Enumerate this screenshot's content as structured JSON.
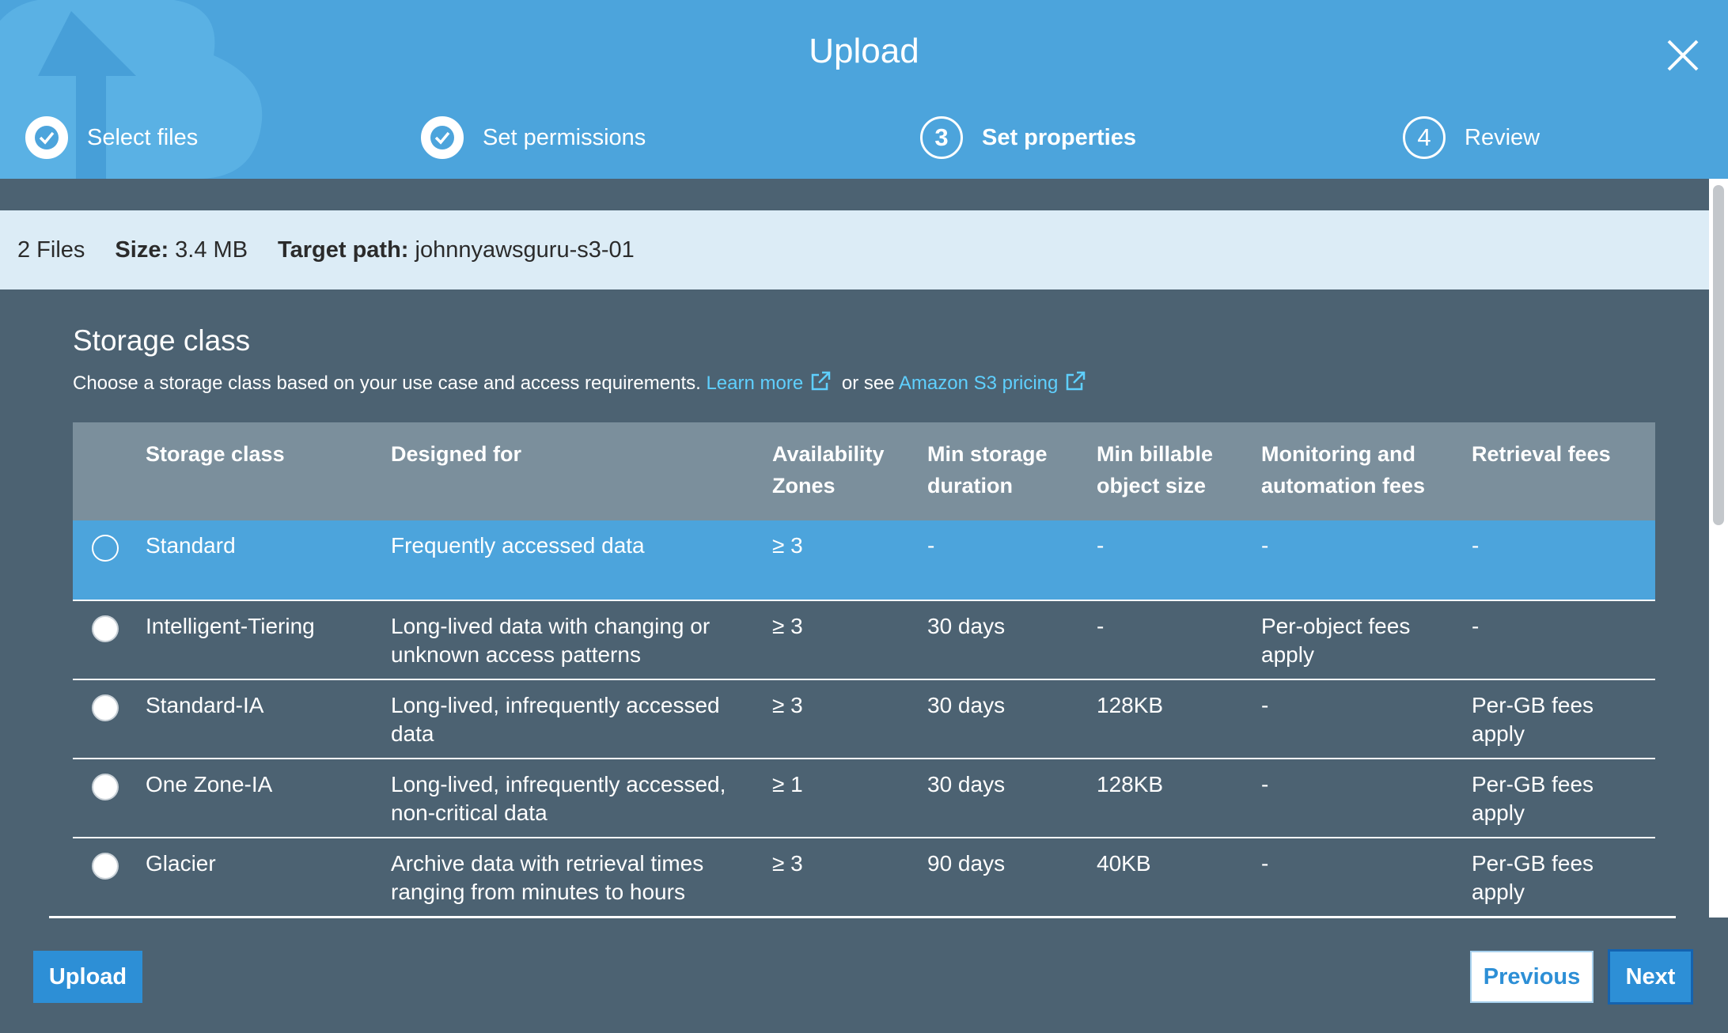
{
  "dialog": {
    "title": "Upload"
  },
  "steps": [
    {
      "label": "Select files",
      "number": "",
      "status": "done"
    },
    {
      "label": "Set permissions",
      "number": "",
      "status": "done"
    },
    {
      "label": "Set properties",
      "number": "3",
      "status": "current"
    },
    {
      "label": "Review",
      "number": "4",
      "status": "upcoming"
    }
  ],
  "info": {
    "files": "2 Files",
    "size_label": "Size:",
    "size_value": "3.4 MB",
    "path_label": "Target path:",
    "path_value": "johnnyawsguru-s3-01"
  },
  "storage": {
    "title": "Storage class",
    "description": "Choose a storage class based on your use case and access requirements.",
    "learn_more": "Learn more",
    "or_see": "or see",
    "pricing_link": "Amazon S3 pricing",
    "columns": [
      "Storage class",
      "Designed for",
      "Availability Zones",
      "Min storage duration",
      "Min billable object size",
      "Monitoring and automation fees",
      "Retrieval fees"
    ],
    "rows": [
      {
        "selected": true,
        "cells": [
          "Standard",
          "Frequently accessed data",
          "≥ 3",
          "-",
          "-",
          "-",
          "-"
        ]
      },
      {
        "selected": false,
        "cells": [
          "Intelligent-Tiering",
          "Long-lived data with changing or unknown access patterns",
          "≥ 3",
          "30 days",
          "-",
          "Per-object fees apply",
          "-"
        ]
      },
      {
        "selected": false,
        "cells": [
          "Standard-IA",
          "Long-lived, infrequently accessed data",
          "≥ 3",
          "30 days",
          "128KB",
          "-",
          "Per-GB fees apply"
        ]
      },
      {
        "selected": false,
        "cells": [
          "One Zone-IA",
          "Long-lived, infrequently accessed, non-critical data",
          "≥ 1",
          "30 days",
          "128KB",
          "-",
          "Per-GB fees apply"
        ]
      },
      {
        "selected": false,
        "cells": [
          "Glacier",
          "Archive data with retrieval times ranging from minutes to hours",
          "≥ 3",
          "90 days",
          "40KB",
          "-",
          "Per-GB fees apply"
        ]
      }
    ]
  },
  "footer": {
    "upload_label": "Upload",
    "previous_label": "Previous",
    "next_label": "Next"
  },
  "colors": {
    "header": "#4ca4dc",
    "background": "#4c6272",
    "table_header": "#7b8f9c",
    "link": "#5fd0ff",
    "button": "#2d8fd6"
  }
}
